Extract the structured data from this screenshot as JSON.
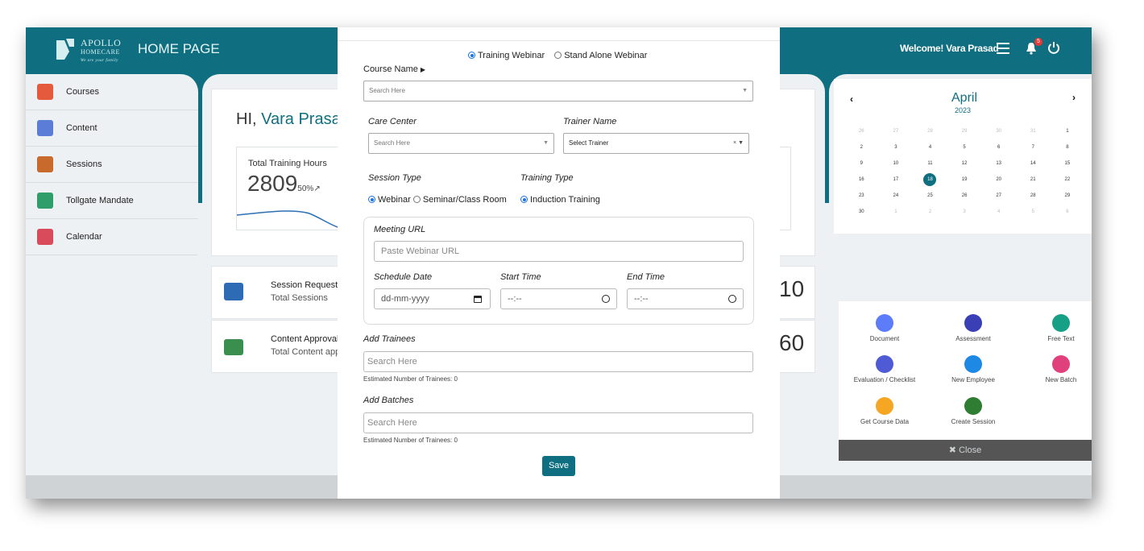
{
  "header": {
    "logo_line1": "APOLLO",
    "logo_line2": "HOMECARE",
    "logo_tagline": "We are your family",
    "title": "HOME PAGE",
    "welcome": "Welcome! Vara Prasad",
    "notification_count": "5"
  },
  "sidebar": {
    "items": [
      {
        "label": "Courses"
      },
      {
        "label": "Content"
      },
      {
        "label": "Sessions"
      },
      {
        "label": "Tollgate Mandate"
      },
      {
        "label": "Calendar"
      }
    ]
  },
  "dashboard": {
    "greeting": "HI,",
    "user_name": "Vara Prasad",
    "hours_label": "Total Training Hours",
    "hours_value": "2809",
    "hours_change": "50%",
    "session_title": "Session Request",
    "session_sub": "Total Sessions",
    "session_count": "10",
    "content_title": "Content Approval",
    "content_sub": "Total Content app",
    "content_count": "60"
  },
  "calendar": {
    "month": "April",
    "year": "2023",
    "today": "18",
    "weeks": [
      [
        "26",
        "27",
        "28",
        "29",
        "30",
        "31",
        "1"
      ],
      [
        "2",
        "3",
        "4",
        "5",
        "6",
        "7",
        "8"
      ],
      [
        "9",
        "10",
        "11",
        "12",
        "13",
        "14",
        "15"
      ],
      [
        "16",
        "17",
        "18",
        "19",
        "20",
        "21",
        "22"
      ],
      [
        "23",
        "24",
        "25",
        "26",
        "27",
        "28",
        "29"
      ],
      [
        "30",
        "1",
        "2",
        "3",
        "4",
        "5",
        "6"
      ]
    ]
  },
  "actions": {
    "items": [
      {
        "label": "Document",
        "color": "#5c7cfa"
      },
      {
        "label": "Assessment",
        "color": "#3b3fb6"
      },
      {
        "label": "Free Text",
        "color": "#16a085"
      },
      {
        "label": "Evaluation / Checklist",
        "color": "#4f5bd5"
      },
      {
        "label": "New Employee",
        "color": "#1e88e5"
      },
      {
        "label": "New Batch",
        "color": "#e0407b"
      },
      {
        "label": "Get Course Data",
        "color": "#f5a623"
      },
      {
        "label": "Create Session",
        "color": "#2e7d32"
      }
    ],
    "close_label": "✖ Close"
  },
  "modal": {
    "webinar_options": [
      "Training Webinar",
      "Stand Alone Webinar"
    ],
    "course_name_label": "Course Name",
    "course_placeholder": "Search Here",
    "care_center_label": "Care Center",
    "care_center_placeholder": "Search Here",
    "trainer_label": "Trainer Name",
    "trainer_placeholder": "Select Trainer",
    "session_type_label": "Session Type",
    "session_types": [
      "Webinar",
      "Seminar/Class Room"
    ],
    "training_type_label": "Training Type",
    "training_types": [
      "Induction Training"
    ],
    "meeting_url_label": "Meeting URL",
    "meeting_url_placeholder": "Paste Webinar URL",
    "schedule_date_label": "Schedule Date",
    "schedule_date_placeholder": "dd-mm-yyyy",
    "start_time_label": "Start Time",
    "end_time_label": "End Time",
    "time_placeholder": "--:--",
    "add_trainees_label": "Add Trainees",
    "trainees_placeholder": "Search Here",
    "trainees_note": "Estimated Number of Trainees: 0",
    "add_batches_label": "Add Batches",
    "batches_placeholder": "Search Here",
    "batches_note": "Estimated Number of Trainees: 0",
    "save_label": "Save"
  },
  "colors": {
    "brand": "#0f6f80",
    "accent_radio": "#1a73e8"
  }
}
